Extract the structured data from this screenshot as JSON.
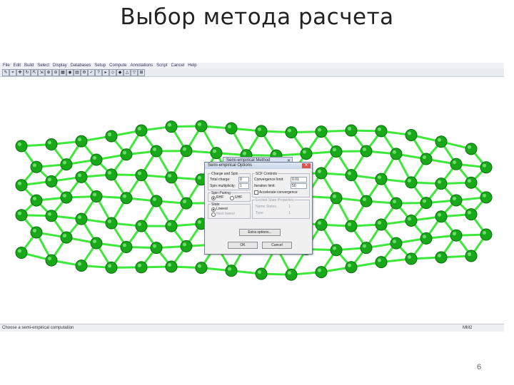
{
  "slide": {
    "title": "Выбор метода расчета",
    "page_number": "6"
  },
  "app": {
    "menu": [
      "File",
      "Edit",
      "Build",
      "Select",
      "Display",
      "Databases",
      "Setup",
      "Compute",
      "Annotations",
      "Script",
      "Cancel",
      "Help"
    ],
    "status_left": "Choose a semi-empirical computation",
    "status_right": "MM2"
  },
  "dialog_back": {
    "title": "Semi-empirical Method"
  },
  "dialog": {
    "title": "Semi-empirical Options",
    "charge_group": "Charge and Spin",
    "total_charge_label": "Total charge:",
    "total_charge_value": "0",
    "multiplicity_label": "Spin multiplicity:",
    "multiplicity_value": "1",
    "spin_pairing_group": "Spin Pairing",
    "rhf_label": "RHF",
    "uhf_label": "UHF",
    "state_group": "State",
    "lowest_label": "Lowest",
    "next_lowest_label": "Next lowest",
    "scf_group": "SCF Controls",
    "convergence_label": "Convergence limit:",
    "convergence_value": "0.01",
    "iteration_label": "Iteration limit:",
    "iteration_value": "50",
    "accelerate_label": "Accelerate convergence",
    "ci_group": "Excited State Properties",
    "ci_row1_label": "Name States",
    "ci_row1_value": "1",
    "ci_row2_label": "Type",
    "ci_row2_value": "1",
    "extra_button": "Extra options...",
    "ok_button": "OK",
    "cancel_button": "Cancel"
  },
  "colors": {
    "atom": "#18a81a",
    "bond": "#3ee83a",
    "dialog_caption": "#c8d5e8"
  }
}
